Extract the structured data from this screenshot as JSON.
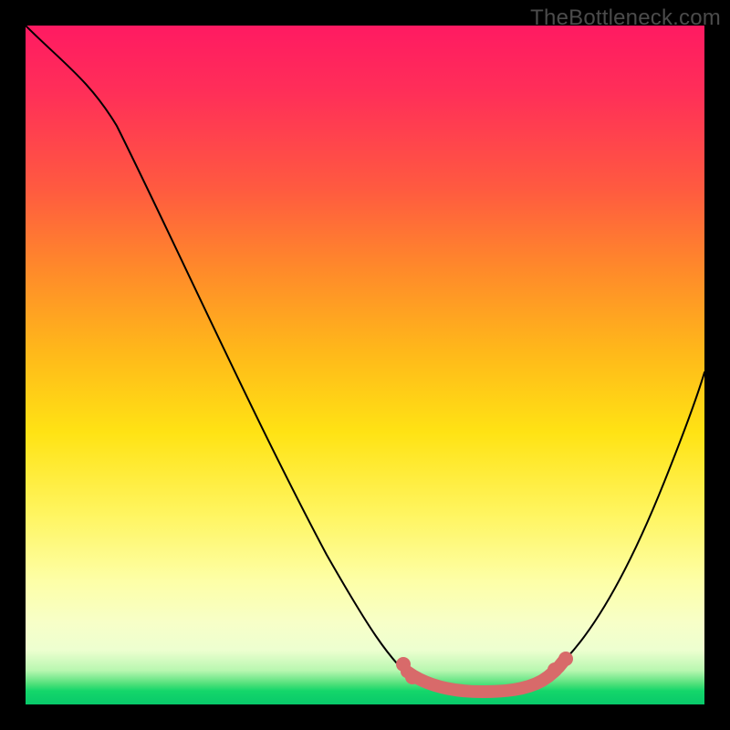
{
  "watermark": "TheBottleneck.com",
  "colors": {
    "highlight": "#d86a6a",
    "curve": "#000000"
  },
  "chart_data": {
    "type": "line",
    "title": "",
    "xlabel": "",
    "ylabel": "",
    "xlim": [
      0,
      100
    ],
    "ylim": [
      0,
      100
    ],
    "grid": false,
    "legend": false,
    "series": [
      {
        "name": "bottleneck-curve",
        "x": [
          0,
          6,
          12,
          18,
          24,
          30,
          36,
          42,
          48,
          54,
          58,
          62,
          66,
          70,
          74,
          78,
          84,
          90,
          96,
          100
        ],
        "values": [
          100,
          96,
          88,
          78,
          66,
          54,
          42,
          30,
          19,
          10,
          5,
          2,
          1,
          1,
          2,
          5,
          14,
          28,
          44,
          56
        ]
      }
    ],
    "annotations": {
      "highlight_range_x": [
        54,
        78
      ],
      "highlight_dots_x": [
        55,
        57,
        76,
        78
      ]
    }
  }
}
